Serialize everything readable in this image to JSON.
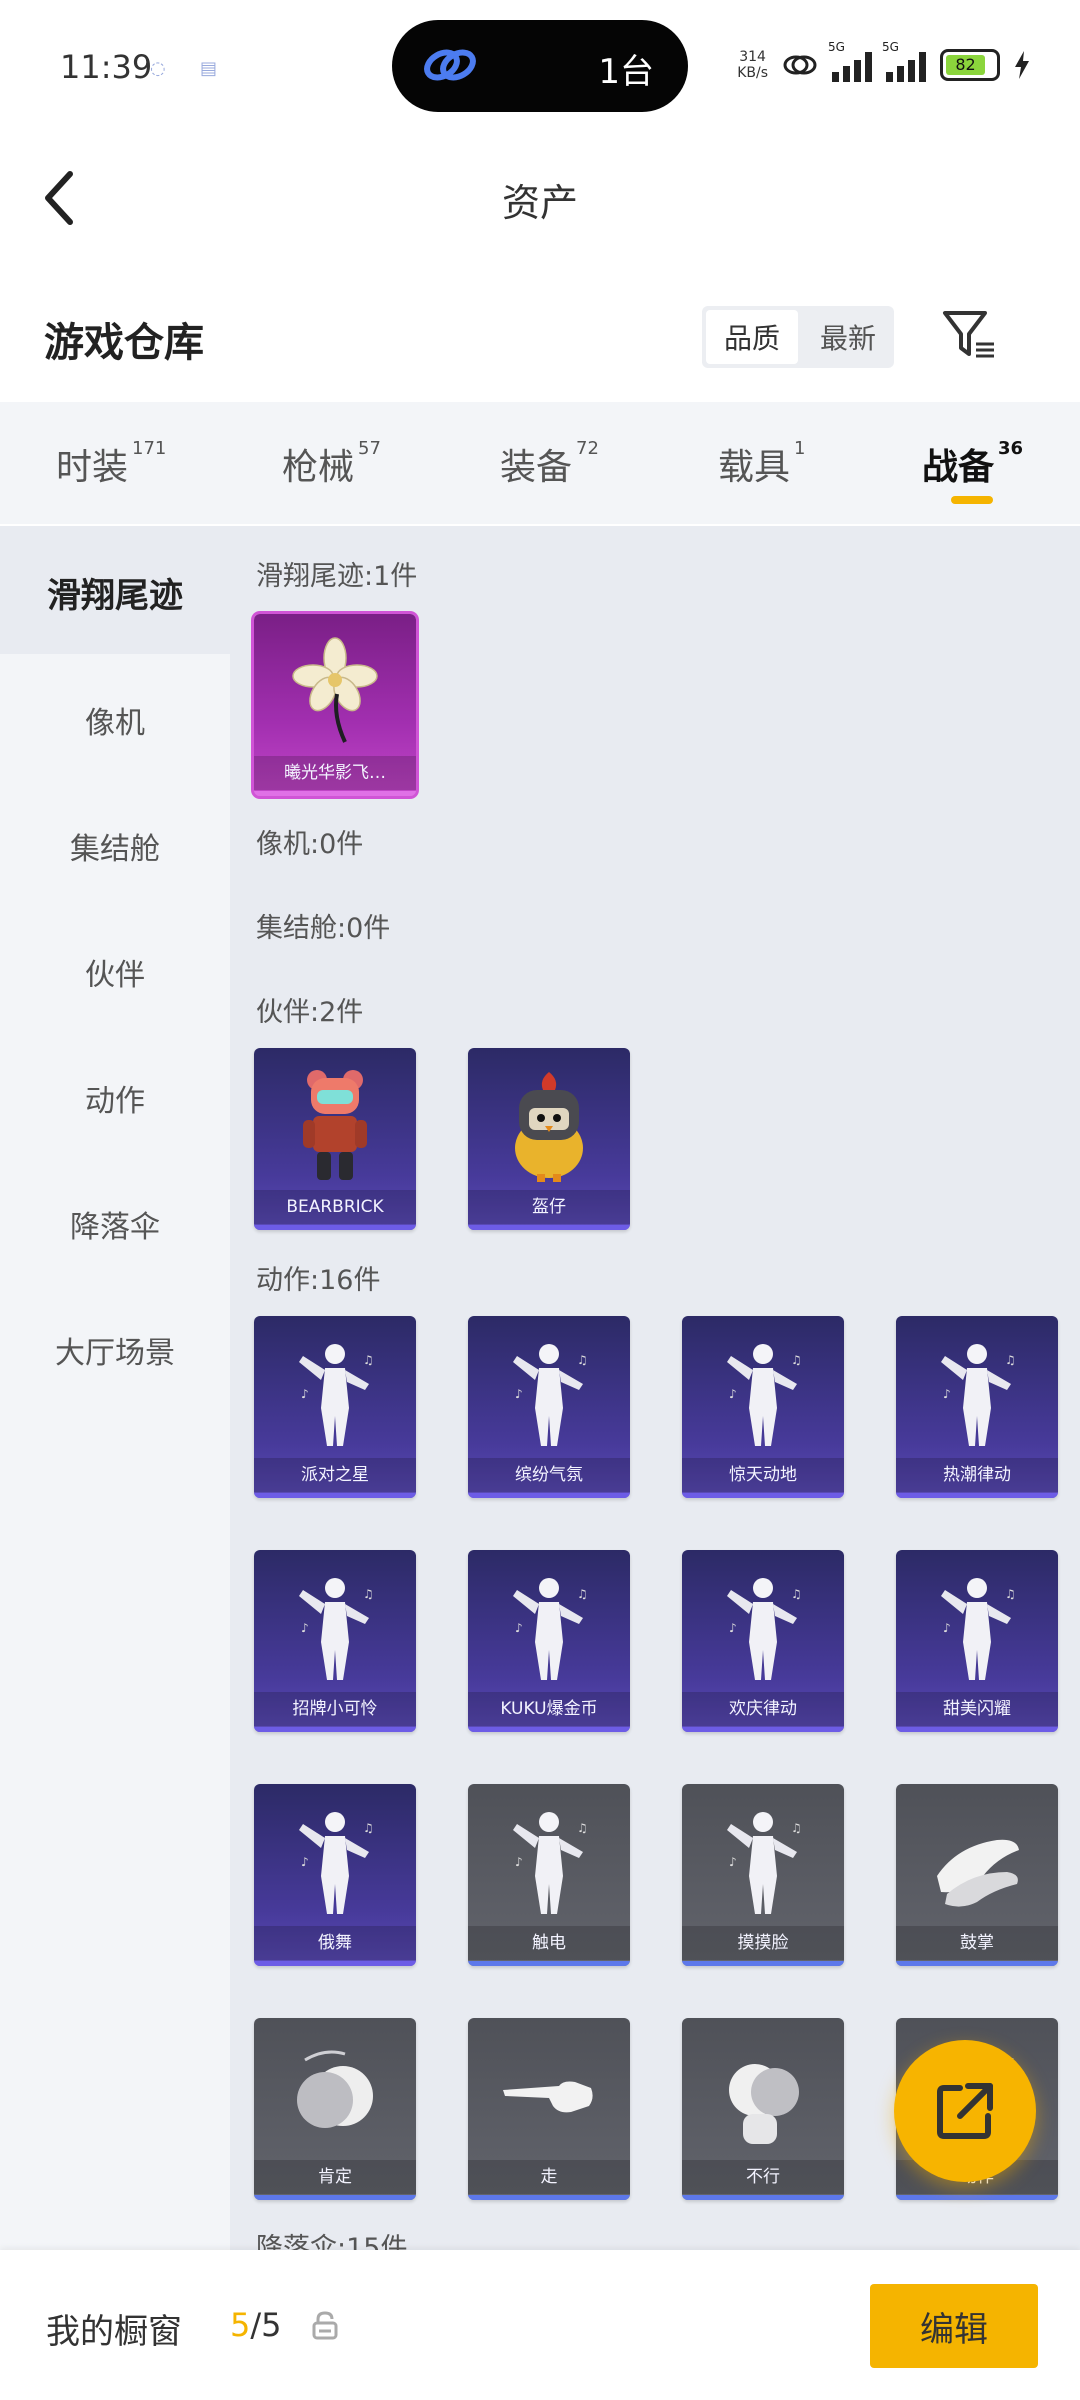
{
  "status": {
    "time": "11:39",
    "island_text": "1台",
    "net_speed_value": "314",
    "net_speed_unit": "KB/s",
    "signal_label_1": "5G",
    "signal_label_2": "5G",
    "battery": "82"
  },
  "header": {
    "title": "资产"
  },
  "warehouse": {
    "title": "游戏仓库",
    "sort_options": [
      "品质",
      "最新"
    ],
    "sort_selected": "品质"
  },
  "categories": [
    {
      "label": "时装",
      "count": "171"
    },
    {
      "label": "枪械",
      "count": "57"
    },
    {
      "label": "装备",
      "count": "72"
    },
    {
      "label": "载具",
      "count": "1"
    },
    {
      "label": "战备",
      "count": "36"
    }
  ],
  "categories_selected": "战备",
  "sidebar": {
    "items": [
      "滑翔尾迹",
      "像机",
      "集结舱",
      "伙伴",
      "动作",
      "降落伞",
      "大厅场景"
    ],
    "selected": "滑翔尾迹"
  },
  "sections": {
    "glide": {
      "label": "滑翔尾迹:1件",
      "items": [
        "曦光华影飞…"
      ]
    },
    "drone": {
      "label": "像机:0件"
    },
    "pod": {
      "label": "集结舱:0件"
    },
    "partner": {
      "label": "伙伴:2件",
      "items": [
        "BEARBRICK",
        "盔仔"
      ]
    },
    "emote": {
      "label": "动作:16件",
      "items": [
        "派对之星",
        "缤纷气氛",
        "惊天动地",
        "热潮律动",
        "招牌小可怜",
        "KUKU爆金币",
        "欢庆律动",
        "甜美闪耀",
        "俄舞",
        "触电",
        "摸摸脸",
        "鼓掌",
        "肯定",
        "走",
        "不行",
        "动作"
      ]
    },
    "parachute": {
      "label": "降落伞:15件"
    }
  },
  "showcase": {
    "title": "我的橱窗",
    "count_current": "5",
    "count_total": "/5",
    "edit_label": "编辑"
  },
  "colors": {
    "accent": "#f5b400",
    "card_purple": "#473a9a",
    "card_pink": "#a22fb0",
    "card_gray": "#5b5d64"
  }
}
